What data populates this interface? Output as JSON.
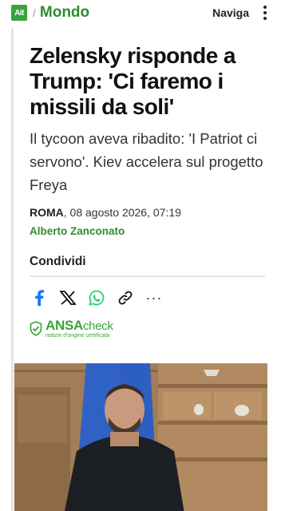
{
  "header": {
    "logo_text": "Ait",
    "section": "Mondo",
    "nav_label": "Naviga"
  },
  "article": {
    "title": "Zelensky risponde a Trump: 'Ci faremo i missili da soli'",
    "subtitle": "Il tycoon aveva ribadito: 'I Patriot ci servono'. Kiev accelera sul progetto Freya",
    "city": "ROMA",
    "datetime": ", 08 agosto 2026, 07:19",
    "author": "Alberto Zanconato"
  },
  "share": {
    "title": "Condividi",
    "icons": [
      "facebook-icon",
      "x-icon",
      "whatsapp-icon",
      "link-icon",
      "more-icon"
    ],
    "more_label": "···"
  },
  "ansa_check": {
    "brand": "ANSA",
    "check": "check",
    "tagline": "notizie d'origine certificata"
  },
  "colors": {
    "brand_green": "#3aa23a",
    "facebook": "#1877f2",
    "whatsapp": "#25d366"
  }
}
